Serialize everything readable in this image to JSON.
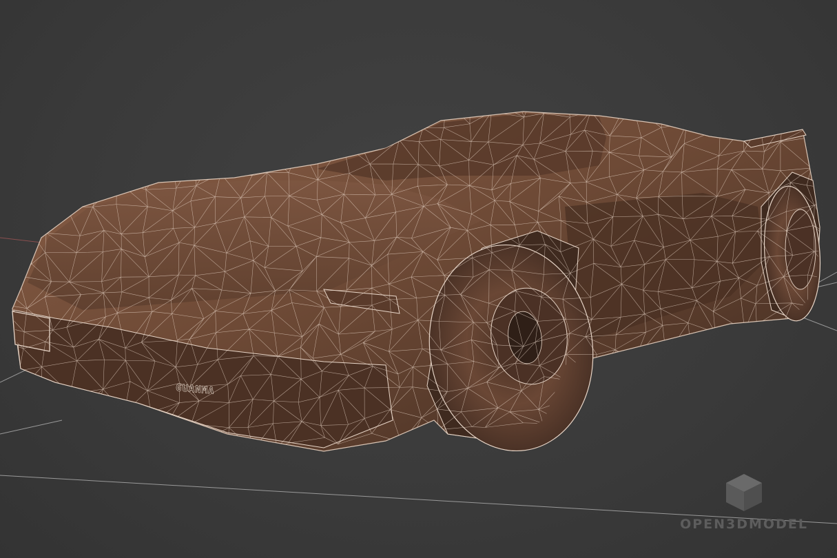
{
  "viewport": {
    "background_color": "#3c3c3c",
    "grid_line_color": "#9a9a9a",
    "axis_line_color": "#8a4f4f"
  },
  "model": {
    "subject": "sports-car",
    "view_mode": "wireframe-on-shaded",
    "base_color": "#6e4a36",
    "highlight_color": "#8a5f47",
    "shadow_color": "#3f2a1f",
    "wire_color": "#e8d6c8",
    "badge_text": "GUANMA"
  },
  "watermark": {
    "icon": "cube-logo-icon",
    "text": "OPEN3DMODEL",
    "color": "#5d5d5d"
  }
}
